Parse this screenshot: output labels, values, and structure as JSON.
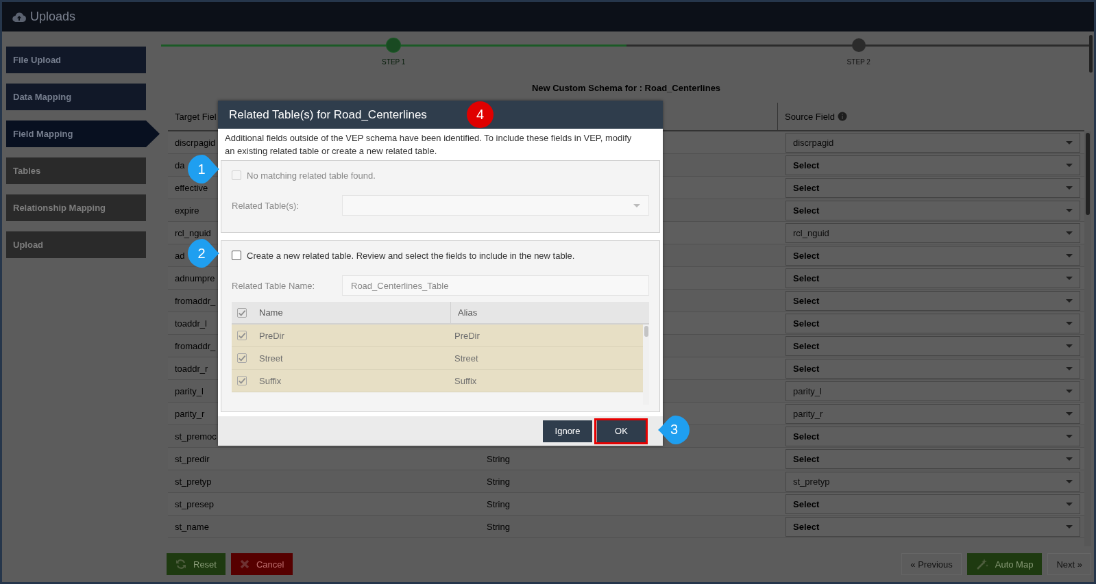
{
  "header": {
    "title": "Uploads"
  },
  "sidebar": {
    "items": [
      {
        "label": "File Upload",
        "selected": false,
        "disabled": false
      },
      {
        "label": "Data Mapping",
        "selected": false,
        "disabled": false
      },
      {
        "label": "Field Mapping",
        "selected": true,
        "disabled": false
      },
      {
        "label": "Tables",
        "selected": false,
        "disabled": true
      },
      {
        "label": "Relationship Mapping",
        "selected": false,
        "disabled": true
      },
      {
        "label": "Upload",
        "selected": false,
        "disabled": true
      }
    ]
  },
  "stepper": {
    "level": 0.5,
    "steps": [
      {
        "label": "STEP 1",
        "selected": true
      },
      {
        "label": "STEP 2",
        "selected": false
      }
    ]
  },
  "schema_title": "New Custom Schema for : Road_Centerlines",
  "table": {
    "columns": [
      "Target Fiel",
      "Source Field"
    ],
    "rows": [
      {
        "target": "discrpagid",
        "source": "discrpagid",
        "kind": "value"
      },
      {
        "target": "da",
        "source": "Select",
        "kind": "placeholder"
      },
      {
        "target": "effective",
        "source": "Select",
        "kind": "placeholder"
      },
      {
        "target": "expire",
        "source": "Select",
        "kind": "placeholder"
      },
      {
        "target": "rcl_nguid",
        "source": "rcl_nguid",
        "kind": "value"
      },
      {
        "target": "ad",
        "source": "Select",
        "kind": "placeholder"
      },
      {
        "target": "adnumpre",
        "source": "Select",
        "kind": "placeholder"
      },
      {
        "target": "fromaddr_",
        "source": "Select",
        "kind": "placeholder"
      },
      {
        "target": "toaddr_l",
        "source": "Select",
        "kind": "placeholder"
      },
      {
        "target": "fromaddr_",
        "source": "Select",
        "kind": "placeholder"
      },
      {
        "target": "toaddr_r",
        "source": "Select",
        "kind": "placeholder"
      },
      {
        "target": "parity_l",
        "source": "parity_l",
        "kind": "value"
      },
      {
        "target": "parity_r",
        "source": "parity_r",
        "kind": "value"
      },
      {
        "target": "st_premoc",
        "source": "Select",
        "kind": "placeholder"
      },
      {
        "target": "st_predir",
        "type": "String",
        "source": "Select",
        "kind": "placeholder"
      },
      {
        "target": "st_pretyp",
        "type": "String",
        "source": "st_pretyp",
        "kind": "value"
      },
      {
        "target": "st_presep",
        "type": "String",
        "source": "Select",
        "kind": "placeholder"
      },
      {
        "target": "st_name",
        "type": "String",
        "source": "Select",
        "kind": "placeholder"
      }
    ]
  },
  "footer": {
    "left_buttons": [
      {
        "label": "Reset",
        "kind": "reset"
      },
      {
        "label": "Cancel",
        "kind": "cancel"
      }
    ],
    "right_buttons": [
      {
        "label": "« Previous",
        "kind": "nav"
      },
      {
        "label": "Auto Map",
        "kind": "automap"
      },
      {
        "label": "Next »",
        "kind": "nav"
      }
    ]
  },
  "dialog": {
    "title": "Related Table(s) for Road_Centerlines",
    "callout": "4",
    "description": "Additional fields outside of the VEP schema have been identified. To include these fields in VEP, modify an existing related table or create a new related table.",
    "existing": {
      "callout": "1",
      "checkbox": {
        "label": "No matching related table found.",
        "checked": false,
        "disabled": true
      },
      "field_label": "Related Table(s):"
    },
    "new_table": {
      "callout": "2",
      "checkbox": {
        "label": "Create a new related table. Review and select the fields to include in the new table.",
        "checked": false,
        "disabled": false
      },
      "name_label": "Related Table Name:",
      "name_value": "Road_Centerlines_Table",
      "header_checked": true,
      "columns": [
        "Name",
        "Alias"
      ],
      "rows": [
        {
          "name": "PreDir",
          "alias": "PreDir",
          "checked": true
        },
        {
          "name": "Street",
          "alias": "Street",
          "checked": true
        },
        {
          "name": "Suffix",
          "alias": "Suffix",
          "checked": true
        }
      ]
    },
    "buttons": [
      {
        "label": "Ignore",
        "highlighted": false
      },
      {
        "label": "OK",
        "highlighted": true,
        "callout": "3"
      }
    ]
  }
}
